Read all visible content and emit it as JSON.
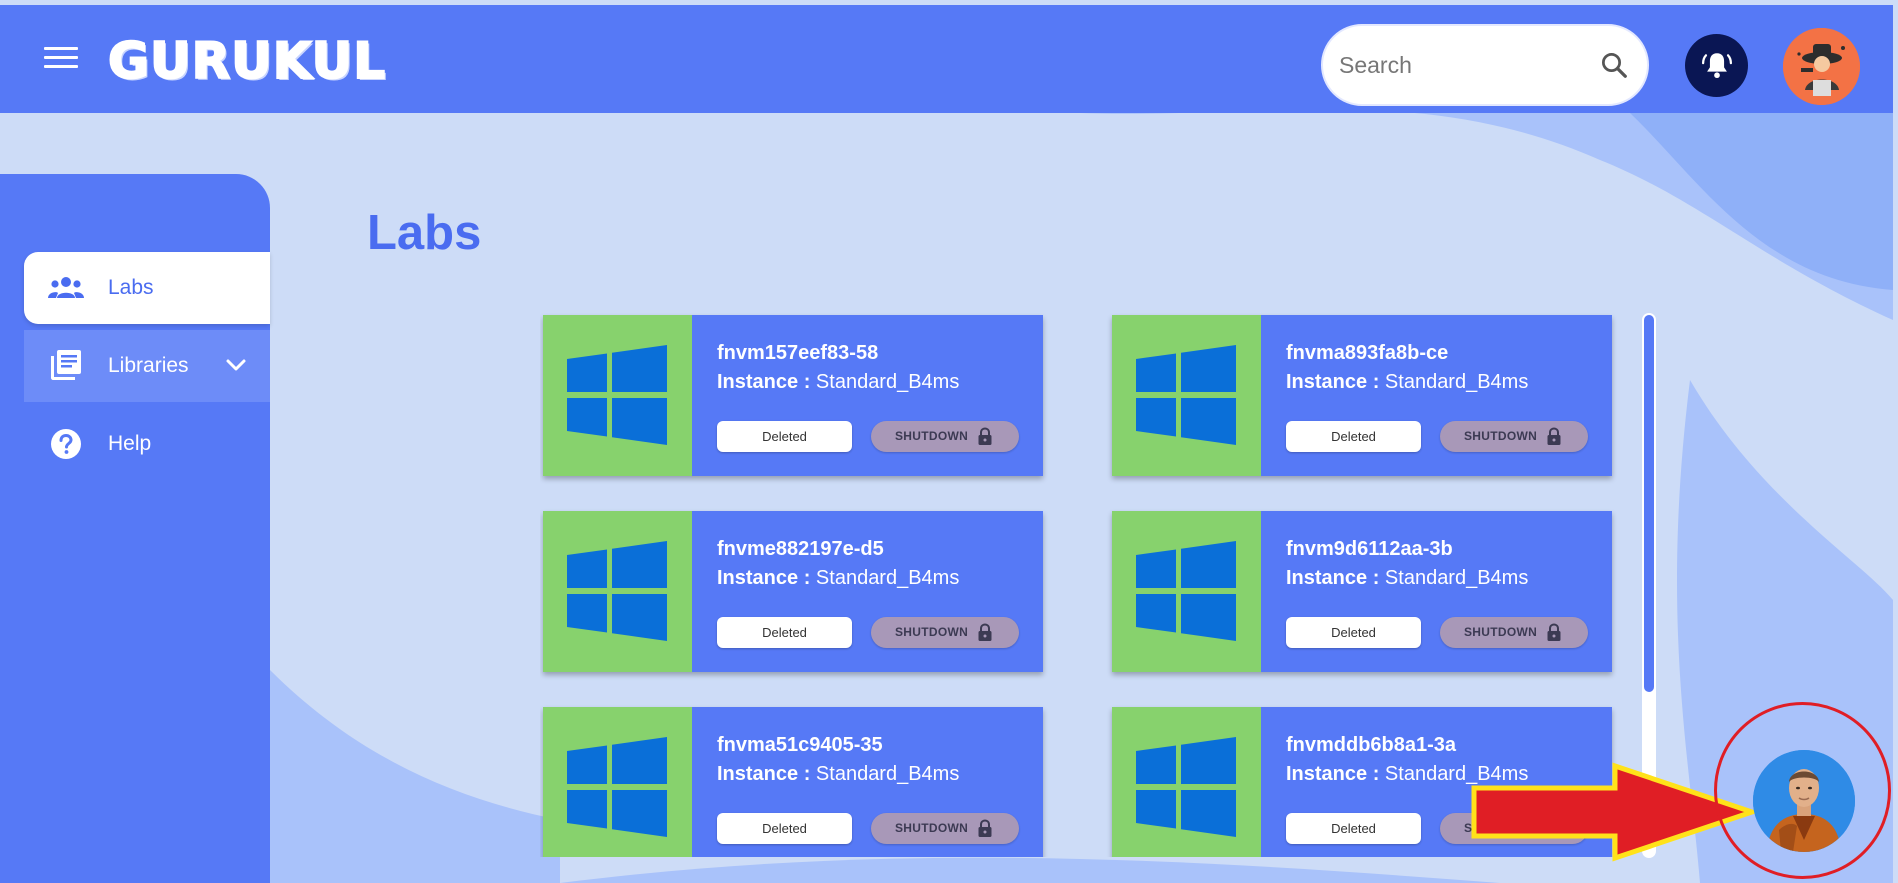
{
  "app": {
    "logo_text": "GURUKUL"
  },
  "header": {
    "search": {
      "placeholder": "Search"
    }
  },
  "sidebar": {
    "items": [
      {
        "label": "Labs",
        "icon": "people-icon",
        "active": true
      },
      {
        "label": "Libraries",
        "icon": "library-books-icon",
        "expandable": true
      },
      {
        "label": "Help",
        "icon": "help-icon"
      }
    ]
  },
  "main": {
    "title": "Labs",
    "instance_prefix": "Instance :",
    "labs": [
      {
        "name": "fnvm157eef83-58",
        "instance": "Standard_B4ms",
        "status": "Deleted",
        "action": "SHUTDOWN"
      },
      {
        "name": "fnvma893fa8b-ce",
        "instance": "Standard_B4ms",
        "status": "Deleted",
        "action": "SHUTDOWN"
      },
      {
        "name": "fnvme882197e-d5",
        "instance": "Standard_B4ms",
        "status": "Deleted",
        "action": "SHUTDOWN"
      },
      {
        "name": "fnvm9d6112aa-3b",
        "instance": "Standard_B4ms",
        "status": "Deleted",
        "action": "SHUTDOWN"
      },
      {
        "name": "fnvma51c9405-35",
        "instance": "Standard_B4ms",
        "status": "Deleted",
        "action": "SHUTDOWN"
      },
      {
        "name": "fnvmddb6b8a1-3a",
        "instance": "Standard_B4ms",
        "status": "Deleted",
        "action": "SHUTDOWN"
      }
    ]
  },
  "colors": {
    "primary": "#5679f6",
    "background_light": "#cddcf7",
    "background_wave": "#a9c2fa",
    "thumb_green": "#87d26d",
    "windows_blue": "#0a6fd8",
    "shutdown_disabled": "#a898b8",
    "annotation_red": "#e01e25",
    "annotation_yellow": "#ffe21a"
  },
  "icons": {
    "menu": "hamburger-menu-icon",
    "search": "search-icon",
    "notifications": "bell-ring-icon",
    "profile": "user-avatar",
    "lab_thumbnail": "windows-logo-icon",
    "shutdown": "lock-icon",
    "assistant": "assistant-avatar"
  }
}
